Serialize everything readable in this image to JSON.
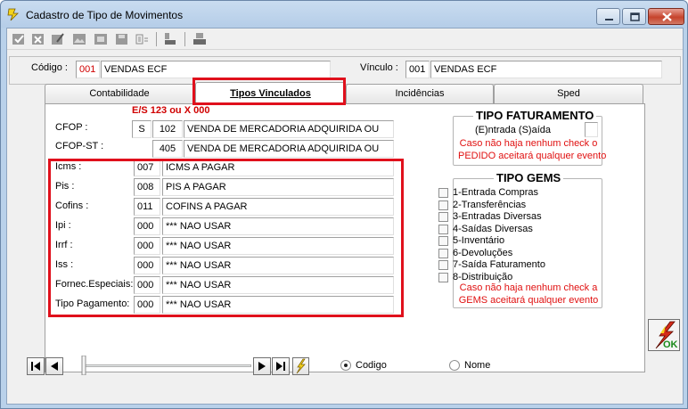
{
  "window": {
    "title": "Cadastro de Tipo de Movimentos"
  },
  "toolbar": {
    "icons": [
      "check-icon",
      "cancel-icon",
      "edit-icon",
      "image-icon",
      "image2-icon",
      "save-icon",
      "list-icon",
      "stamp-icon",
      "print-icon"
    ]
  },
  "header": {
    "codigo_label": "Código :",
    "codigo_code": "001",
    "codigo_desc": "VENDAS ECF",
    "vinculo_label": "Vínculo :",
    "vinculo_code": "001",
    "vinculo_desc": "VENDAS ECF"
  },
  "tabs": [
    {
      "label": "Contabilidade"
    },
    {
      "label": "Tipos Vinculados"
    },
    {
      "label": "Incidências"
    },
    {
      "label": "Sped"
    }
  ],
  "vinculados": {
    "es_hint": "E/S 123   ou   X 000",
    "cfop": {
      "label": "CFOP :",
      "es": "S",
      "code": "102",
      "desc": "VENDA DE MERCADORIA ADQUIRIDA OU"
    },
    "cfop_st": {
      "label": "CFOP-ST :",
      "code": "405",
      "desc": "VENDA DE MERCADORIA ADQUIRIDA OU"
    },
    "rows": [
      {
        "label": "Icms :",
        "code": "007",
        "desc": "ICMS A PAGAR"
      },
      {
        "label": "Pis :",
        "code": "008",
        "desc": "PIS A PAGAR"
      },
      {
        "label": "Cofins :",
        "code": "011",
        "desc": "COFINS A PAGAR"
      },
      {
        "label": "Ipi :",
        "code": "000",
        "desc": "*** NAO USAR"
      },
      {
        "label": "Irrf :",
        "code": "000",
        "desc": "*** NAO USAR"
      },
      {
        "label": "Iss :",
        "code": "000",
        "desc": "*** NAO USAR"
      },
      {
        "label": "Fornec.Especiais:",
        "code": "000",
        "desc": "*** NAO USAR"
      },
      {
        "label": "Tipo Pagamento:",
        "code": "000",
        "desc": "*** NAO USAR"
      }
    ]
  },
  "faturamento": {
    "title": "TIPO FATURAMENTO",
    "options": "(E)ntrada      (S)aída",
    "value": "",
    "note1": "Caso não haja nenhum check o",
    "note2": "PEDIDO aceitará qualquer evento"
  },
  "gems": {
    "title": "TIPO GEMS",
    "items": [
      {
        "label": "1-Entrada Compras",
        "checked": false
      },
      {
        "label": "2-Transferências",
        "checked": false
      },
      {
        "label": "3-Entradas Diversas",
        "checked": false
      },
      {
        "label": "4-Saídas Diversas",
        "checked": false
      },
      {
        "label": "5-Inventário",
        "checked": false
      },
      {
        "label": "6-Devoluções",
        "checked": false
      },
      {
        "label": "7-Saída Faturamento",
        "checked": false
      },
      {
        "label": "8-Distribuição",
        "checked": false
      }
    ],
    "note1": "Caso não haja nenhum check a",
    "note2": "GEMS aceitará qualquer evento"
  },
  "ok_button": {
    "label": "OK"
  },
  "order": {
    "codigo_label": "Codigo",
    "nome_label": "Nome",
    "selected": "Codigo"
  },
  "colors": {
    "highlight": "#e0101c",
    "note": "#e01010",
    "title_bg": "#b9d1ea"
  }
}
